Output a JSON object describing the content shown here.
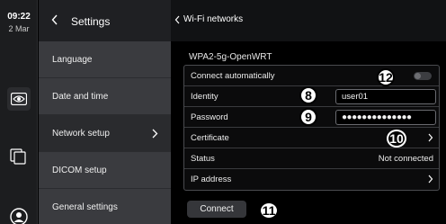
{
  "status_bar": {
    "time": "09:22",
    "date": "2 Mar"
  },
  "settings": {
    "title": "Settings",
    "items": [
      {
        "label": "Language"
      },
      {
        "label": "Date and time"
      },
      {
        "label": "Network setup"
      },
      {
        "label": "DICOM setup"
      },
      {
        "label": "General settings"
      }
    ],
    "active_item": "Network setup"
  },
  "wifi": {
    "back_label": "Wi-Fi networks",
    "network_name": "WPA2-5g-OpenWRT",
    "rows": {
      "connect_auto": {
        "label": "Connect automatically",
        "toggle_on": false
      },
      "identity": {
        "label": "Identity",
        "value": "user01"
      },
      "password": {
        "label": "Password",
        "value": "●●●●●●●●●●●●●●"
      },
      "certificate": {
        "label": "Certificate"
      },
      "status": {
        "label": "Status",
        "value": "Not connected"
      },
      "ip_address": {
        "label": "IP address"
      }
    },
    "connect_label": "Connect"
  },
  "callouts": {
    "c8": "8",
    "c9": "9",
    "c10": "10",
    "c11": "11",
    "c12": "12"
  },
  "colors": {
    "background": "#000000",
    "panel": "#3a3b3f",
    "active": "#2a2b2e"
  },
  "icons": [
    "eye-icon",
    "files-icon",
    "user-icon",
    "back-chevron-icon",
    "chevron-right-icon"
  ]
}
